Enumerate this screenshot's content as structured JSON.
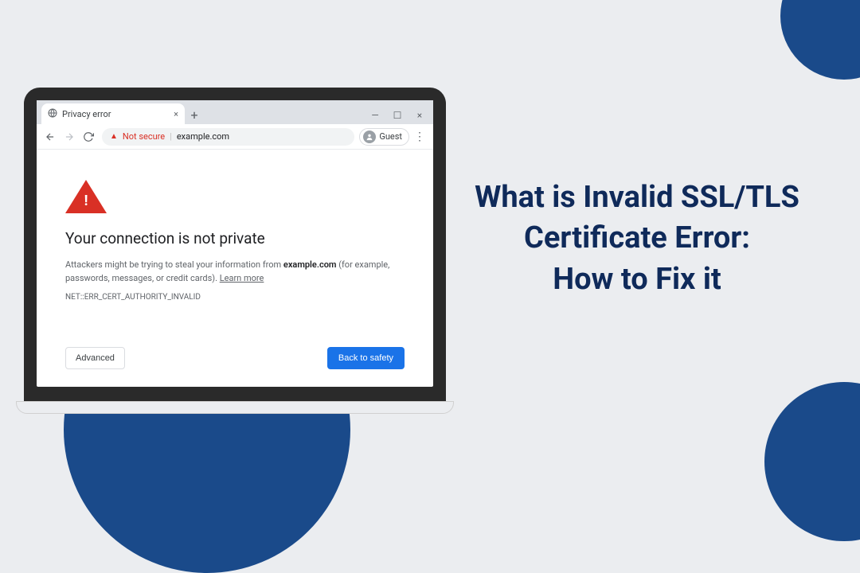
{
  "headline": {
    "line1": "What is Invalid SSL/TLS",
    "line2": "Certificate Error:",
    "line3": "How to Fix it"
  },
  "browser": {
    "tab": {
      "title": "Privacy error",
      "close": "×"
    },
    "new_tab": "+",
    "window_controls": {
      "minimize": "—",
      "maximize": "☐",
      "close": "×"
    },
    "toolbar": {
      "not_secure": "Not secure",
      "url": "example.com",
      "guest": "Guest",
      "kebab": "⋮"
    },
    "page": {
      "heading": "Your connection is not private",
      "body_prefix": "Attackers might be trying to steal your information from ",
      "body_domain": "example.com",
      "body_suffix": " (for example, passwords, messages, or credit cards). ",
      "learn_more": "Learn more",
      "error_code": "NET::ERR_CERT_AUTHORITY_INVALID",
      "advanced": "Advanced",
      "back_to_safety": "Back to safety"
    }
  }
}
